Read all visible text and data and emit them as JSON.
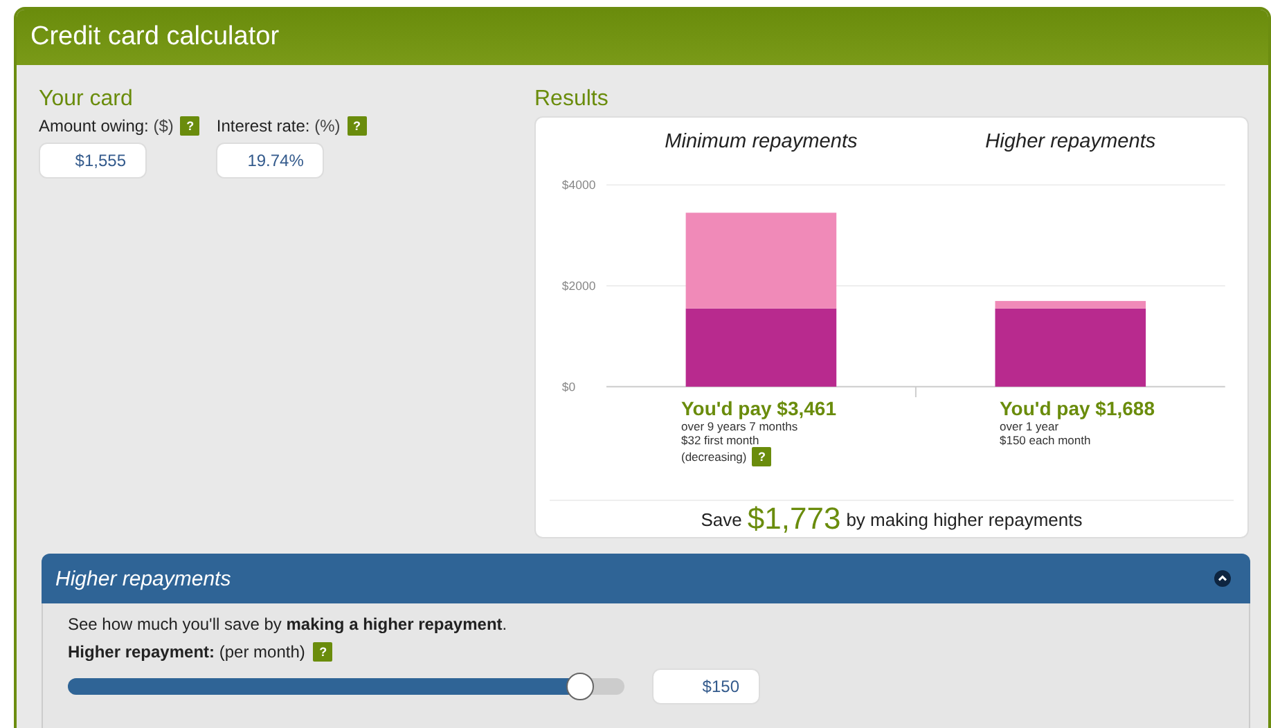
{
  "title": "Credit card calculator",
  "your_card": {
    "heading": "Your card",
    "fields": [
      {
        "label": "Amount owing:",
        "unit": "($)",
        "help": "?",
        "value": "$1,555"
      },
      {
        "label": "Interest rate:",
        "unit": "(%)",
        "help": "?",
        "value": "19.74%"
      }
    ]
  },
  "results": {
    "heading": "Results",
    "chart_data": {
      "type": "bar",
      "stacked": true,
      "categories": [
        "Minimum repayments",
        "Higher repayments"
      ],
      "series": [
        {
          "color": "#b82a8e",
          "values": [
            1550,
            1550
          ]
        },
        {
          "color": "#f08ab8",
          "values": [
            1900,
            150
          ]
        }
      ],
      "ylim": [
        0,
        4000
      ],
      "yticks": [
        {
          "value": 0,
          "label": "$0"
        },
        {
          "value": 2000,
          "label": "$2000"
        },
        {
          "value": 4000,
          "label": "$4000"
        }
      ]
    },
    "outcomes": [
      {
        "total": "You'd pay $3,461",
        "lines": [
          "over 9 years 7 months",
          "$32 first month",
          "(decreasing)"
        ],
        "help": "?"
      },
      {
        "total": "You'd pay $1,688",
        "lines": [
          "over 1 year",
          "$150 each month"
        ]
      }
    ],
    "saving": {
      "before": "Save",
      "amount": "$1,773",
      "after": "by making higher repayments"
    }
  },
  "higher": {
    "title": "Higher repayments",
    "expanded": true,
    "intro": "See how much you'll save by **making a higher repayment**.",
    "label": "Higher repayment:",
    "unit": "(per month)",
    "help": "?",
    "slider": {
      "level": 0.92
    },
    "value": "$150"
  }
}
